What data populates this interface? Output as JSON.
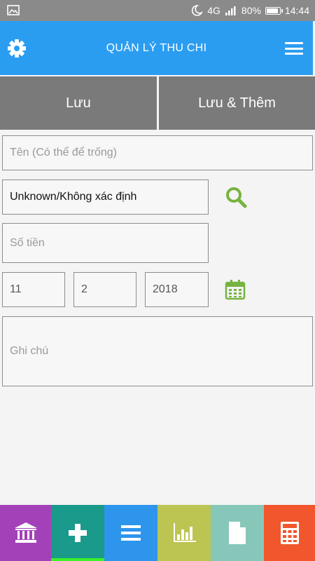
{
  "status_bar": {
    "network": "4G",
    "battery": "80%",
    "time": "14:44"
  },
  "app_bar": {
    "title": "QUẢN LÝ THU CHI"
  },
  "actions": {
    "save_label": "Lưu",
    "save_add_label": "Lưu & Thêm"
  },
  "form": {
    "name_placeholder": "Tên (Có thể để trống)",
    "category_value": "Unknown/Không xác định",
    "amount_placeholder": "Số tiền",
    "day": "11",
    "month": "2",
    "year": "2018",
    "note_placeholder": "Ghi chú"
  },
  "icons": {
    "settings": "gear-icon",
    "menu": "hamburger-menu-icon",
    "search": "search-icon",
    "calendar": "calendar-icon"
  },
  "bottom_nav": {
    "items": [
      "bank-icon",
      "plus-icon",
      "list-icon",
      "bar-chart-icon",
      "document-icon",
      "calculator-icon"
    ],
    "active_index": 1
  },
  "colors": {
    "app_bar": "#2b9df1",
    "action_button": "#7a7a7a",
    "accent_green": "#77b340",
    "nav_active_indicator": "#3cf02a"
  }
}
